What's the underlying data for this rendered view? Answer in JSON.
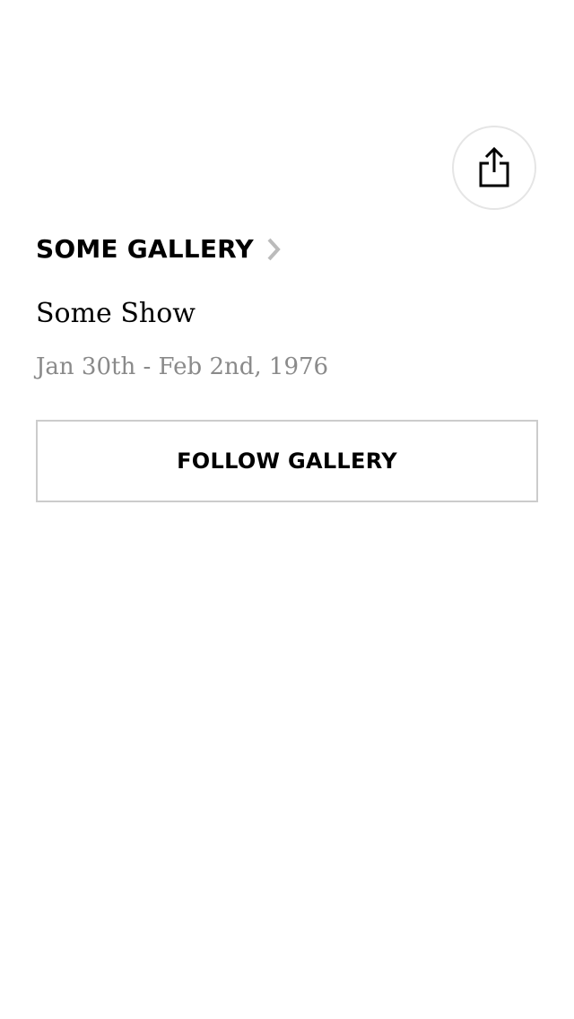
{
  "header": {
    "share_icon": "share-icon"
  },
  "gallery": {
    "name": "SOME GALLERY",
    "chevron_icon": "chevron-right-icon"
  },
  "show": {
    "title": "Some Show",
    "dates": "Jan 30th - Feb 2nd, 1976"
  },
  "actions": {
    "follow_label": "FOLLOW GALLERY"
  },
  "colors": {
    "background": "#ffffff",
    "text_primary": "#000000",
    "text_secondary": "#8a8a8a",
    "border": "#cccccc",
    "chevron": "#bbbbbb"
  }
}
